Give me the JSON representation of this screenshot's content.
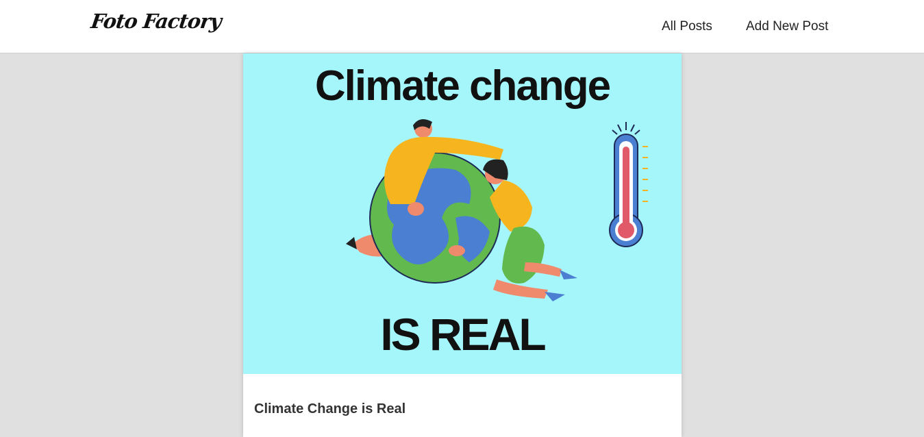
{
  "brand": {
    "logo_text": "Foto Factory"
  },
  "nav": {
    "all_posts": "All Posts",
    "add_new_post": "Add New Post"
  },
  "post": {
    "image": {
      "heading": "Climate change",
      "footer": "IS REAL"
    },
    "title": "Climate Change is Real"
  },
  "colors": {
    "page_bg": "#e0e0e0",
    "navbar_bg": "#ffffff",
    "image_bg": "#a5f6fb",
    "globe_ocean": "#4a7fd1",
    "globe_land": "#62b94e",
    "shirt": "#f6b51f",
    "thermometer_red": "#e05a6a"
  }
}
